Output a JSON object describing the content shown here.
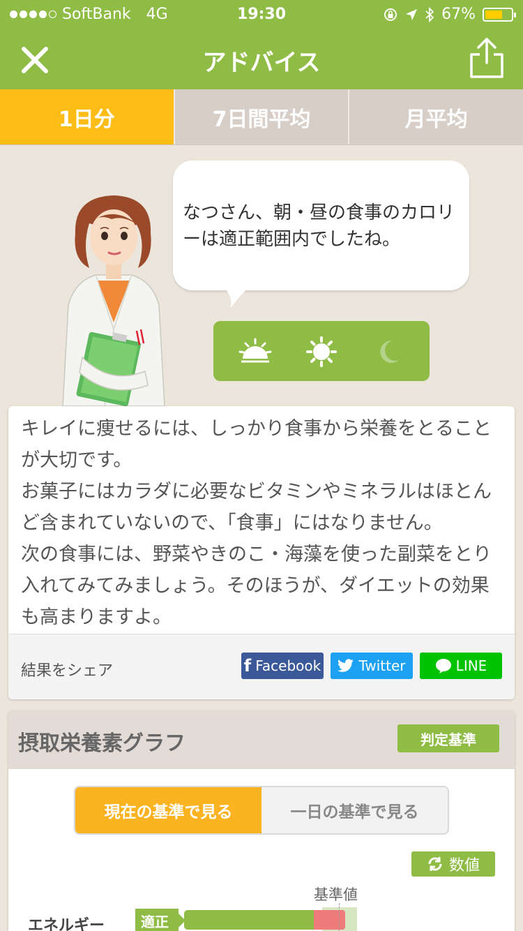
{
  "status": {
    "carrier": "SoftBank",
    "network": "4G",
    "time": "19:30",
    "battery": "67%",
    "battery_level": 0.67,
    "signal_bars": 4,
    "signal_total": 5
  },
  "nav": {
    "title": "アドバイス",
    "left_icon": "close-icon",
    "right_icon": "share-icon"
  },
  "tabs": [
    {
      "label": "1日分",
      "active": true
    },
    {
      "label": "7日間平均",
      "active": false
    },
    {
      "label": "月平均",
      "active": false
    }
  ],
  "bubble": {
    "text": "なつさん、朝・昼の食事のカロリーは適正範囲内でしたね。"
  },
  "meals": [
    {
      "icon": "sunrise-icon",
      "active": true
    },
    {
      "icon": "sun-icon",
      "active": true
    },
    {
      "icon": "moon-icon",
      "active": false
    }
  ],
  "advice": {
    "text": "キレイに痩せるには、しっかり食事から栄養をとることが大切です。\nお菓子にはカラダに必要なビタミンやミネラルはほとんど含まれていないので、「食事」にはなりません。\n次の食事には、野菜やきのこ・海藻を使った副菜をとり入れてみてみましょう。そのほうが、ダイエットの効果も高まりますよ。"
  },
  "share": {
    "label": "結果をシェア",
    "facebook": "Facebook",
    "twitter": "Twitter",
    "line": "LINE"
  },
  "graph": {
    "title": "摂取栄養素グラフ",
    "criteria_button": "判定基準",
    "segments": [
      {
        "label": "現在の基準で見る",
        "active": true
      },
      {
        "label": "一日の基準で見る",
        "active": false
      }
    ],
    "value_button": "数値",
    "standard_label": "基準値",
    "rows": [
      {
        "label": "エネルギー",
        "badge": "適正",
        "green_fraction": 0.75,
        "red_fraction": 0.18
      }
    ]
  },
  "colors": {
    "brand_green": "#8fbc45",
    "tab_active": "#fdbd16",
    "segment_active": "#fbb321",
    "facebook": "#3b5998",
    "twitter": "#1da1f2",
    "line": "#00c300",
    "over_red": "#f07b7b"
  }
}
